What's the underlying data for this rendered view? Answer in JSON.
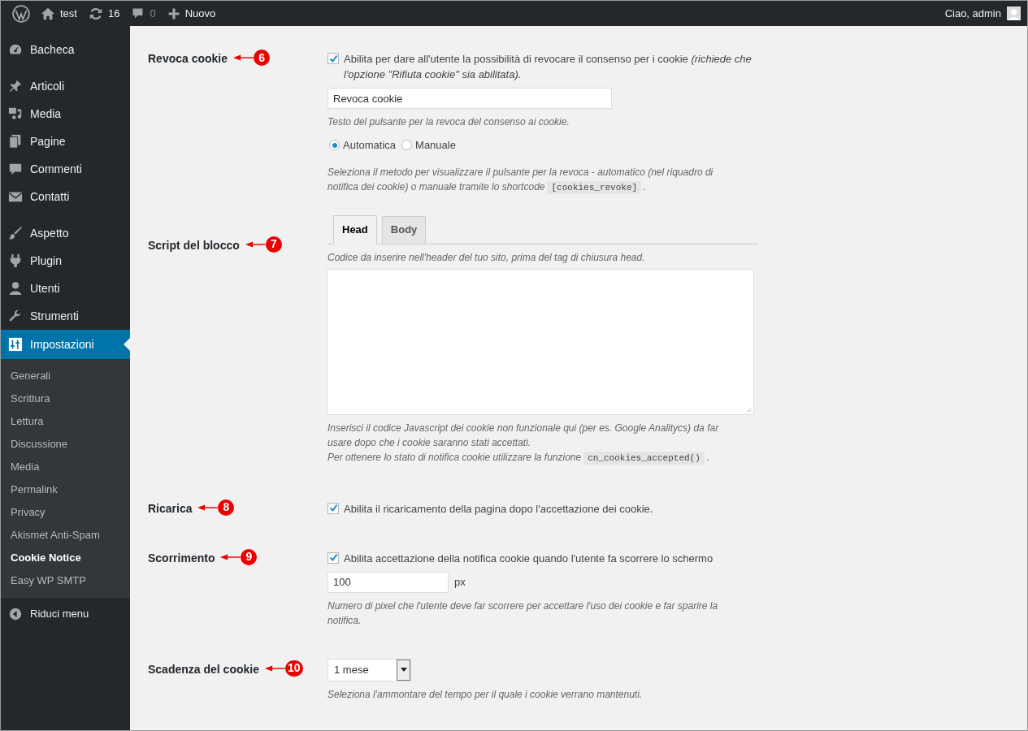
{
  "topbar": {
    "items": [
      {
        "kind": "logo"
      },
      {
        "kind": "home",
        "text": "test"
      },
      {
        "kind": "updates",
        "text": "16"
      },
      {
        "kind": "comments",
        "text": "0"
      },
      {
        "kind": "new",
        "text": "Nuovo"
      }
    ],
    "greeting": "Ciao, admin"
  },
  "sidebar": {
    "groups": [
      [
        {
          "label": "Bacheca",
          "selected": false
        }
      ],
      [
        {
          "label": "Articoli",
          "selected": false
        },
        {
          "label": "Media",
          "selected": false
        },
        {
          "label": "Pagine",
          "selected": false
        },
        {
          "label": "Commenti",
          "selected": false
        },
        {
          "label": "Contatti",
          "selected": false
        }
      ],
      [
        {
          "label": "Aspetto",
          "selected": false
        },
        {
          "label": "Plugin",
          "selected": false
        },
        {
          "label": "Utenti",
          "selected": false
        },
        {
          "label": "Strumenti",
          "selected": false
        },
        {
          "label": "Impostazioni",
          "selected": true,
          "expanded": true,
          "children": [
            {
              "label": "Generali",
              "selected": false
            },
            {
              "label": "Scrittura",
              "selected": false
            },
            {
              "label": "Lettura",
              "selected": false
            },
            {
              "label": "Discussione",
              "selected": false
            },
            {
              "label": "Media",
              "selected": false
            },
            {
              "label": "Permalink",
              "selected": false
            },
            {
              "label": "Privacy",
              "selected": false
            },
            {
              "label": "Akismet Anti-Spam",
              "selected": false
            },
            {
              "label": "Cookie Notice",
              "selected": true
            },
            {
              "label": "Easy WP SMTP",
              "selected": false
            }
          ]
        }
      ]
    ],
    "collapse": "Riduci menu"
  },
  "sections": [
    {
      "label": "Revoca cookie",
      "marker": "6",
      "fields": [
        {
          "kind": "checkbox",
          "checked": true,
          "text": "Abilita per dare all'utente la possibilità di revocare il consenso per i cookie *(richiede che l'opzione \"Rifiuta cookie\" sia abilitata).*"
        },
        {
          "kind": "input",
          "value": "Revoca cookie"
        },
        {
          "kind": "hint",
          "paragraphs": [
            [
              {
                "text": "Testo del pulsante per la revoca del consenso ai cookie."
              }
            ]
          ]
        },
        {
          "kind": "radios",
          "options": [
            {
              "label": "Automatica",
              "selected": true
            },
            {
              "label": "Manuale",
              "selected": false
            }
          ]
        },
        {
          "kind": "hint",
          "paragraphs": [
            [
              {
                "text": "Seleziona il metodo per visualizzare il pulsante per la revoca - automatico (nel riquadro di notifica dei cookie) o manuale tramite lo shortcode"
              },
              {
                "code": "[cookies_revoke]"
              },
              {
                "text": "."
              }
            ]
          ]
        }
      ]
    },
    {
      "label": "Script del blocco",
      "marker": "7",
      "fields": [
        {
          "kind": "tabs",
          "tabs": [
            {
              "label": "Head",
              "selected": true
            },
            {
              "label": "Body",
              "selected": false
            }
          ]
        },
        {
          "kind": "hint",
          "paragraphs": [
            [
              {
                "text": "Codice da inserire nell'header del tuo sito, prima del tag di chiusura head."
              }
            ]
          ]
        },
        {
          "kind": "textarea"
        },
        {
          "kind": "hint",
          "paragraphs": [
            [
              {
                "text": "Inserisci il codice Javascript dei cookie non funzionale qui (per es. Google Analitycs) da far usare dopo che i cookie saranno stati accettati."
              }
            ],
            [
              {
                "text": "Per ottenere lo stato di notifica cookie utilizzare la funzione"
              },
              {
                "code": "cn_cookies_accepted()"
              },
              {
                "text": "."
              }
            ]
          ]
        }
      ]
    },
    {
      "label": "Ricarica",
      "marker": "8",
      "fields": [
        {
          "kind": "checkbox",
          "checked": true,
          "text": "Abilita il ricaricamento della pagina dopo l'accettazione dei cookie."
        }
      ]
    },
    {
      "label": "Scorrimento",
      "marker": "9",
      "fields": [
        {
          "kind": "checkbox",
          "checked": true,
          "text": "Abilita accettazione della notifica cookie quando l'utente fa scorrere lo schermo"
        },
        {
          "kind": "input",
          "value": "100",
          "unit": "px"
        },
        {
          "kind": "hint",
          "paragraphs": [
            [
              {
                "text": "Numero di pixel che l'utente deve far scorrere per accettare l'uso dei cookie e far sparire la notifica."
              }
            ]
          ]
        }
      ]
    },
    {
      "label": "Scadenza del cookie",
      "marker": "10",
      "fields": [
        {
          "kind": "select",
          "value": "1 mese"
        },
        {
          "kind": "hint",
          "paragraphs": [
            [
              {
                "text": "Seleziona l'ammontare del tempo per il quale i cookie verrano mantenuti."
              }
            ]
          ]
        }
      ]
    }
  ]
}
